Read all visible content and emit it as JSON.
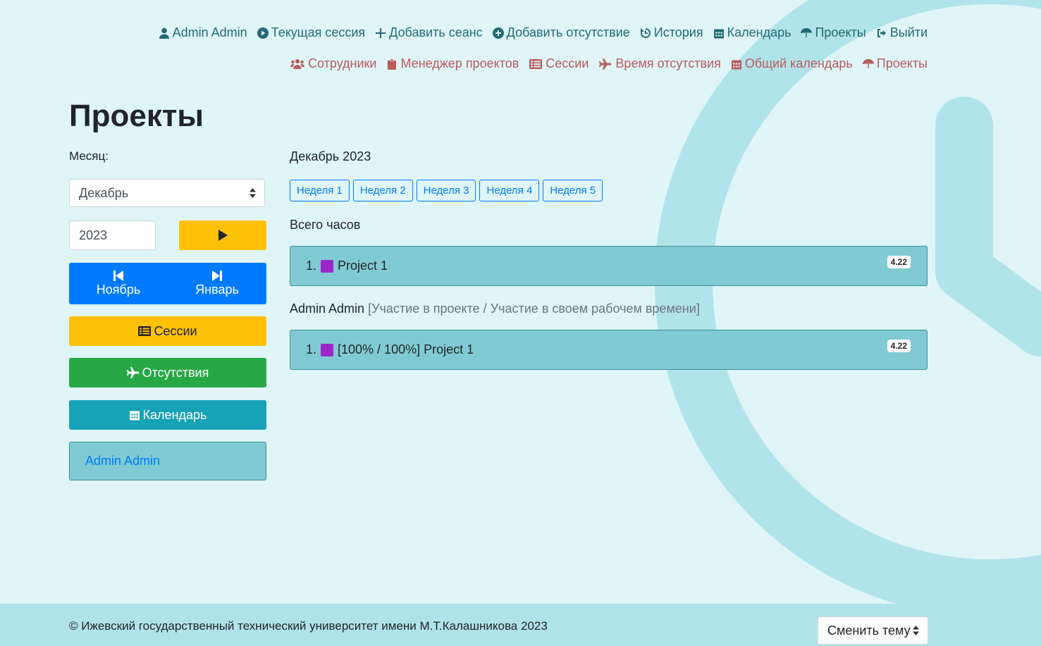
{
  "nav_primary": [
    {
      "label": "Admin Admin",
      "icon": "user-icon"
    },
    {
      "label": "Текущая сессия",
      "icon": "play-circle-icon"
    },
    {
      "label": "Добавить сеанс",
      "icon": "plus-icon"
    },
    {
      "label": "Добавить отсутствие",
      "icon": "plus-circle-icon"
    },
    {
      "label": "История",
      "icon": "history-icon"
    },
    {
      "label": "Календарь",
      "icon": "calendar-icon"
    },
    {
      "label": "Проекты",
      "icon": "umbrella-icon"
    },
    {
      "label": "Выйти",
      "icon": "sign-out-icon"
    }
  ],
  "nav_admin": [
    {
      "label": "Сотрудники",
      "icon": "users-icon"
    },
    {
      "label": "Менеджер проектов",
      "icon": "clipboard-icon"
    },
    {
      "label": "Сессии",
      "icon": "list-icon"
    },
    {
      "label": "Время отсутствия",
      "icon": "plane-icon"
    },
    {
      "label": "Общий календарь",
      "icon": "calendar-icon"
    },
    {
      "label": "Проекты",
      "icon": "umbrella-icon"
    }
  ],
  "page": {
    "title": "Проекты"
  },
  "filters": {
    "month_label": "Месяц:",
    "month_value": "Декабрь",
    "year_value": "2023",
    "prev_month": "Ноябрь",
    "next_month": "Январь"
  },
  "sidebar_buttons": {
    "sessions": "Сессии",
    "absences": "Отсутствия",
    "calendar": "Календарь",
    "user": "Admin Admin"
  },
  "report": {
    "period": "Декабрь 2023",
    "weeks": [
      "Неделя 1",
      "Неделя 2",
      "Неделя 3",
      "Неделя 4",
      "Неделя 5"
    ],
    "total_label": "Всего часов",
    "total_rows": [
      {
        "index": "1.",
        "name": "Project 1",
        "hours": "4.22",
        "color": "#9c27c8"
      }
    ],
    "user_name": "Admin Admin",
    "user_note": "[Участие в проекте / Участие в своем рабочем времени]",
    "user_rows": [
      {
        "index": "1.",
        "name": "[100% / 100%] Project 1",
        "hours": "4.22",
        "color": "#9c27c8"
      }
    ]
  },
  "footer": {
    "copyright": "© Ижевский государственный технический университет имени М.Т.Калашникова 2023",
    "theme_button": "Сменить тему"
  },
  "colors": {
    "background": "#dff5f7",
    "accent": "#80cbd3",
    "primary": "#007bff",
    "warning": "#ffc107",
    "success": "#28a745",
    "info": "#17a2b8"
  }
}
